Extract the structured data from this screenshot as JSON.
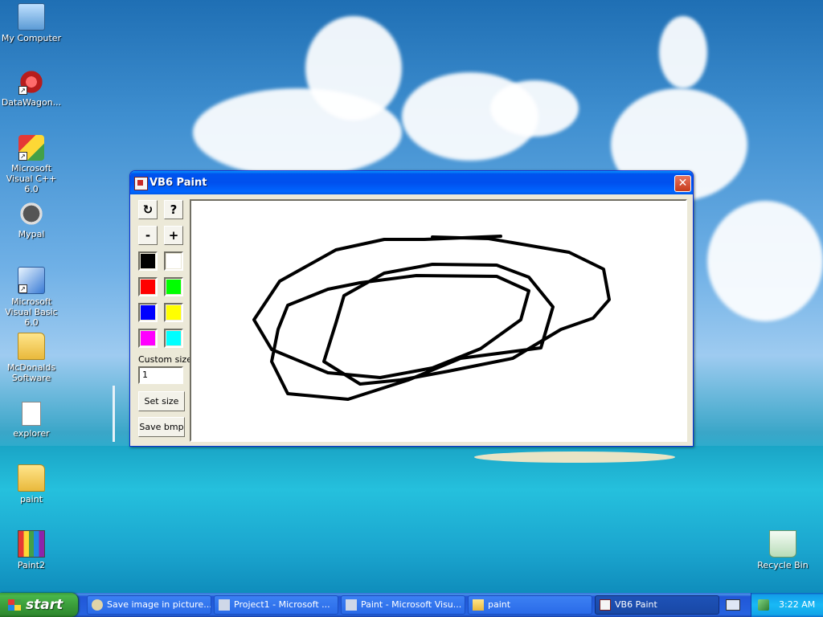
{
  "desktop": {
    "icons": [
      {
        "label": "My Computer",
        "icon": "computer-icon"
      },
      {
        "label": "DataWagon...",
        "icon": "datawagon-icon"
      },
      {
        "label": "Microsoft Visual C++ 6.0",
        "icon": "visual-cpp-icon"
      },
      {
        "label": "Mypal",
        "icon": "mypal-icon"
      },
      {
        "label": "Microsoft Visual Basic 6.0",
        "icon": "visual-basic-icon"
      },
      {
        "label": "McDonalds Software",
        "icon": "folder-icon"
      },
      {
        "label": "explorer",
        "icon": "file-icon"
      },
      {
        "label": "paint",
        "icon": "folder-icon"
      },
      {
        "label": "Paint2",
        "icon": "paint-icon"
      },
      {
        "label": "Recycle Bin",
        "icon": "recycle-bin-icon"
      }
    ]
  },
  "window": {
    "title": "VB6 Paint",
    "close_glyph": "✕",
    "buttons": {
      "clear": "↻",
      "help": "?",
      "minus": "-",
      "plus": "+",
      "set_size": "Set size",
      "save_bmp": "Save bmp"
    },
    "palette": [
      {
        "name": "black",
        "color": "#000000"
      },
      {
        "name": "white",
        "color": "#ffffff"
      },
      {
        "name": "red",
        "color": "#ff0000"
      },
      {
        "name": "green",
        "color": "#00ff00"
      },
      {
        "name": "blue",
        "color": "#0000ff"
      },
      {
        "name": "yellow",
        "color": "#ffff00"
      },
      {
        "name": "magenta",
        "color": "#ff00ff"
      },
      {
        "name": "cyan",
        "color": "#00ffff"
      }
    ],
    "custom_size_label": "Custom size:",
    "custom_size_value": "1"
  },
  "taskbar": {
    "start_label": "start",
    "tasks": [
      {
        "label": "Save image in picture...",
        "active": false
      },
      {
        "label": "Project1 - Microsoft ...",
        "active": false
      },
      {
        "label": "Paint - Microsoft Visu...",
        "active": false
      },
      {
        "label": "paint",
        "active": false
      },
      {
        "label": "VB6 Paint",
        "active": true
      }
    ],
    "clock": "3:22 AM"
  },
  "colors": {
    "titlebar": "#0054e3",
    "window_face": "#ece9d8",
    "taskbar": "#245edb",
    "start_button": "#3c9a3c",
    "stroke": "#000000"
  }
}
